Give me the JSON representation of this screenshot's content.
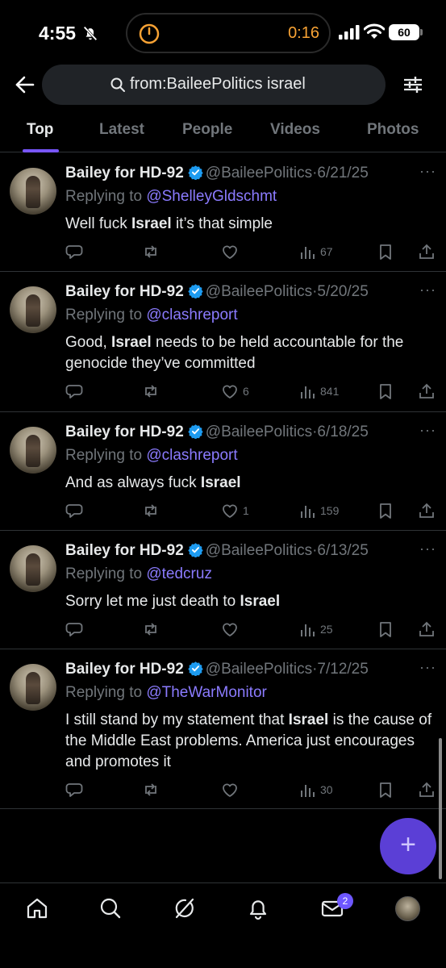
{
  "status_bar": {
    "time": "4:55",
    "timer": "0:16",
    "battery": "60"
  },
  "search": {
    "query": "from:BaileePolitics israel"
  },
  "tabs": [
    {
      "label": "Top",
      "active": true
    },
    {
      "label": "Latest"
    },
    {
      "label": "People"
    },
    {
      "label": "Videos"
    },
    {
      "label": "Photos"
    }
  ],
  "tweets": [
    {
      "display_name": "Bailey for HD-92",
      "handle": "@BaileePolitics",
      "dot": "·",
      "date": "6/21/25",
      "replying_prefix": "Replying to ",
      "replying_to": "@ShelleyGldschmt",
      "text_parts": [
        "Well fuck ",
        "Israel",
        " it’s that simple"
      ],
      "likes": "",
      "views": "67"
    },
    {
      "display_name": "Bailey for HD-92",
      "handle": "@BaileePolitics",
      "dot": "·",
      "date": "5/20/25",
      "replying_prefix": "Replying to ",
      "replying_to": "@clashreport",
      "text_parts": [
        "Good, ",
        "Israel",
        " needs to be held accountable for the genocide they’ve committed"
      ],
      "likes": "6",
      "views": "841"
    },
    {
      "display_name": "Bailey for HD-92",
      "handle": "@BaileePolitics",
      "dot": "·",
      "date": "6/18/25",
      "replying_prefix": "Replying to ",
      "replying_to": "@clashreport",
      "text_parts": [
        "And as always fuck ",
        "Israel",
        ""
      ],
      "likes": "1",
      "views": "159"
    },
    {
      "display_name": "Bailey for HD-92",
      "handle": "@BaileePolitics",
      "dot": "·",
      "date": "6/13/25",
      "replying_prefix": "Replying to ",
      "replying_to": "@tedcruz",
      "text_parts": [
        "Sorry let me just death to ",
        "Israel",
        ""
      ],
      "likes": "",
      "views": "25"
    },
    {
      "display_name": "Bailey for HD-92",
      "handle": "@BaileePolitics",
      "dot": "·",
      "date": "7/12/25",
      "replying_prefix": "Replying to ",
      "replying_to": "@TheWarMonitor",
      "text_parts": [
        "I still stand by my statement that ",
        "Israel",
        " is the cause of the Middle East problems. America just encourages and promotes it"
      ],
      "likes": "",
      "views": "30"
    }
  ],
  "more_label": "···",
  "fab_label": "+",
  "bottom_nav": {
    "messages_badge": "2"
  },
  "colors": {
    "accent": "#7856ff",
    "mention": "#8b7bff",
    "muted": "#71767b",
    "timer": "#f7a234"
  },
  "icons": [
    "bell-slash-icon",
    "timer-icon",
    "signal-icon",
    "wifi-icon",
    "back-arrow-icon",
    "search-icon",
    "filter-icon",
    "verified-icon",
    "reply-icon",
    "retweet-icon",
    "like-icon",
    "views-icon",
    "bookmark-icon",
    "share-icon",
    "home-icon",
    "explore-icon",
    "grok-icon",
    "notifications-icon",
    "messages-icon"
  ]
}
